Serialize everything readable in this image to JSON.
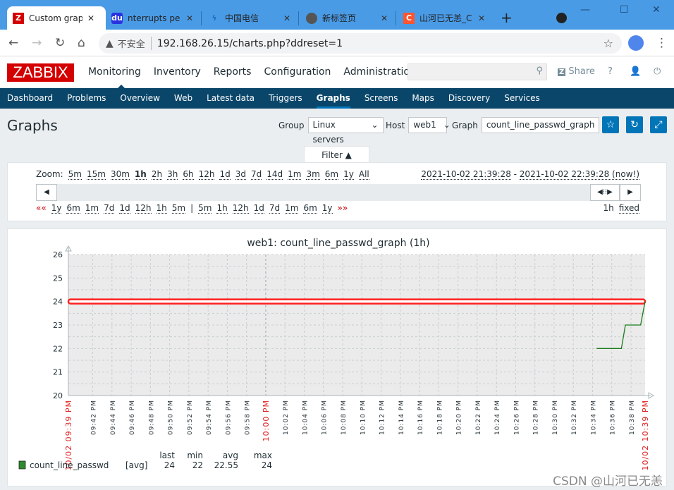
{
  "browser": {
    "tabs": [
      {
        "title": "Custom grap",
        "icon": "zabbix-icon",
        "active": true
      },
      {
        "title": "nterrupts pe",
        "icon": "baidu-icon"
      },
      {
        "title": "中国电信",
        "icon": "telecom-icon"
      },
      {
        "title": "新标签页",
        "icon": "globe-icon"
      },
      {
        "title": "山河已无恙_C",
        "icon": "csdn-icon"
      }
    ],
    "insecure_label": "不安全",
    "url": "192.168.26.15/charts.php?ddreset=1"
  },
  "header": {
    "logo": "ZABBIX",
    "menu": [
      "Monitoring",
      "Inventory",
      "Reports",
      "Configuration",
      "Administration"
    ],
    "share": "Share",
    "help": "?"
  },
  "submenu": [
    "Dashboard",
    "Problems",
    "Overview",
    "Web",
    "Latest data",
    "Triggers",
    "Graphs",
    "Screens",
    "Maps",
    "Discovery",
    "Services"
  ],
  "page": {
    "title": "Graphs",
    "group_label": "Group",
    "group_value": "Linux servers",
    "host_label": "Host",
    "host_value": "web1",
    "graph_label": "Graph",
    "graph_value": "count_line_passwd_graph"
  },
  "filter": {
    "tab_label": "Filter ▲",
    "zoom_label": "Zoom:",
    "zoom_options": [
      "5m",
      "15m",
      "30m",
      "1h",
      "2h",
      "3h",
      "6h",
      "12h",
      "1d",
      "3d",
      "7d",
      "14d",
      "1m",
      "3m",
      "6m",
      "1y",
      "All"
    ],
    "range_from": "2021-10-02 21:39:28",
    "range_to": "2021-10-02 22:39:28 (now!)",
    "back_label": "««",
    "back_options": [
      "1y",
      "6m",
      "1m",
      "7d",
      "1d",
      "12h",
      "1h",
      "5m"
    ],
    "forward_options": [
      "5m",
      "1h",
      "12h",
      "1d",
      "7d",
      "1m",
      "6m",
      "1y"
    ],
    "forward_label": "»»",
    "period": "1h",
    "fixed": "fixed"
  },
  "chart_data": {
    "type": "line",
    "title": "web1: count_line_passwd_graph (1h)",
    "ylim": [
      20,
      26
    ],
    "yticks": [
      20,
      21,
      22,
      23,
      24,
      25,
      26
    ],
    "xlim": [
      "21:39:28",
      "22:39:28"
    ],
    "x_start_label": "10/02 09:39 PM",
    "x_end_label": "10/02 10:39 PM",
    "x_major_label": "10:00 PM",
    "xticks": [
      "09:42 PM",
      "09:44 PM",
      "09:46 PM",
      "09:48 PM",
      "09:50 PM",
      "09:52 PM",
      "09:54 PM",
      "09:56 PM",
      "09:58 PM",
      "10:00 PM",
      "10:02 PM",
      "10:04 PM",
      "10:06 PM",
      "10:08 PM",
      "10:10 PM",
      "10:12 PM",
      "10:14 PM",
      "10:16 PM",
      "10:18 PM",
      "10:20 PM",
      "10:22 PM",
      "10:24 PM",
      "10:26 PM",
      "10:28 PM",
      "10:30 PM",
      "10:32 PM",
      "10:34 PM",
      "10:36 PM",
      "10:38 PM"
    ],
    "grid": true,
    "series": [
      {
        "name": "count_line_passwd",
        "color": "#1a7c1a",
        "points": [
          [
            "22:34:25",
            22
          ],
          [
            "22:37:00",
            22
          ],
          [
            "22:37:25",
            23
          ],
          [
            "22:39:00",
            23
          ],
          [
            "22:39:28",
            24
          ]
        ]
      }
    ],
    "threshold": {
      "value": 24,
      "color": "#ff2020"
    },
    "legend": {
      "headers": [
        "last",
        "min",
        "avg",
        "max"
      ],
      "item": "count_line_passwd",
      "func": "[avg]",
      "last": "24",
      "min": "22",
      "avg": "22.55",
      "max": "24",
      "color": "#2d8a2d"
    }
  },
  "watermark": "CSDN @山河已无恙"
}
